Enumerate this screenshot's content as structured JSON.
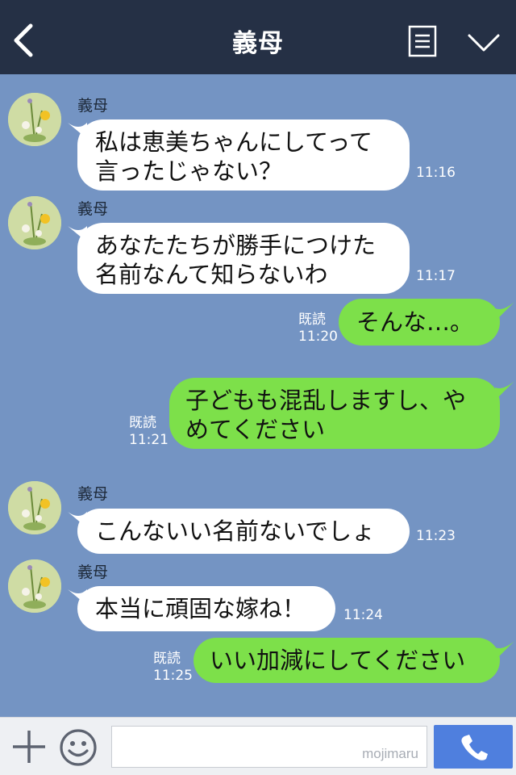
{
  "header": {
    "title": "義母",
    "icons": {
      "back": "chevron-left-icon",
      "menu": "menu-icon",
      "collapse": "chevron-down-icon"
    }
  },
  "messages": [
    {
      "side": "in",
      "sender": "義母",
      "lines": [
        "私は恵美ちゃんにしてって",
        "言ったじゃない？"
      ],
      "time": "11:16"
    },
    {
      "side": "in",
      "sender": "義母",
      "lines": [
        "あなたたちが勝手につけた",
        "名前なんて知らないわ"
      ],
      "time": "11:17"
    },
    {
      "side": "out",
      "read": "既読",
      "lines": [
        "そんな…。"
      ],
      "time": "11:20"
    },
    {
      "side": "out",
      "read": "既読",
      "lines": [
        "子どもも混乱しますし、や",
        "めてください"
      ],
      "time": "11:21"
    },
    {
      "side": "in",
      "sender": "義母",
      "lines": [
        "こんないい名前ないでしょ"
      ],
      "time": "11:23"
    },
    {
      "side": "in",
      "sender": "義母",
      "lines": [
        "本当に頑固な嫁ね！"
      ],
      "time": "11:24"
    },
    {
      "side": "out",
      "read": "既読",
      "lines": [
        "いい加減にしてください"
      ],
      "time": "11:25"
    }
  ],
  "footer": {
    "watermark": "mojimaru",
    "icons": {
      "plus": "plus-icon",
      "emoji": "smiley-icon",
      "call": "phone-icon"
    }
  },
  "colors": {
    "header_bg": "#253045",
    "chat_bg": "#7494c3",
    "incoming_bubble": "#ffffff",
    "outgoing_bubble": "#7de04a",
    "call_button": "#4f7fde"
  }
}
